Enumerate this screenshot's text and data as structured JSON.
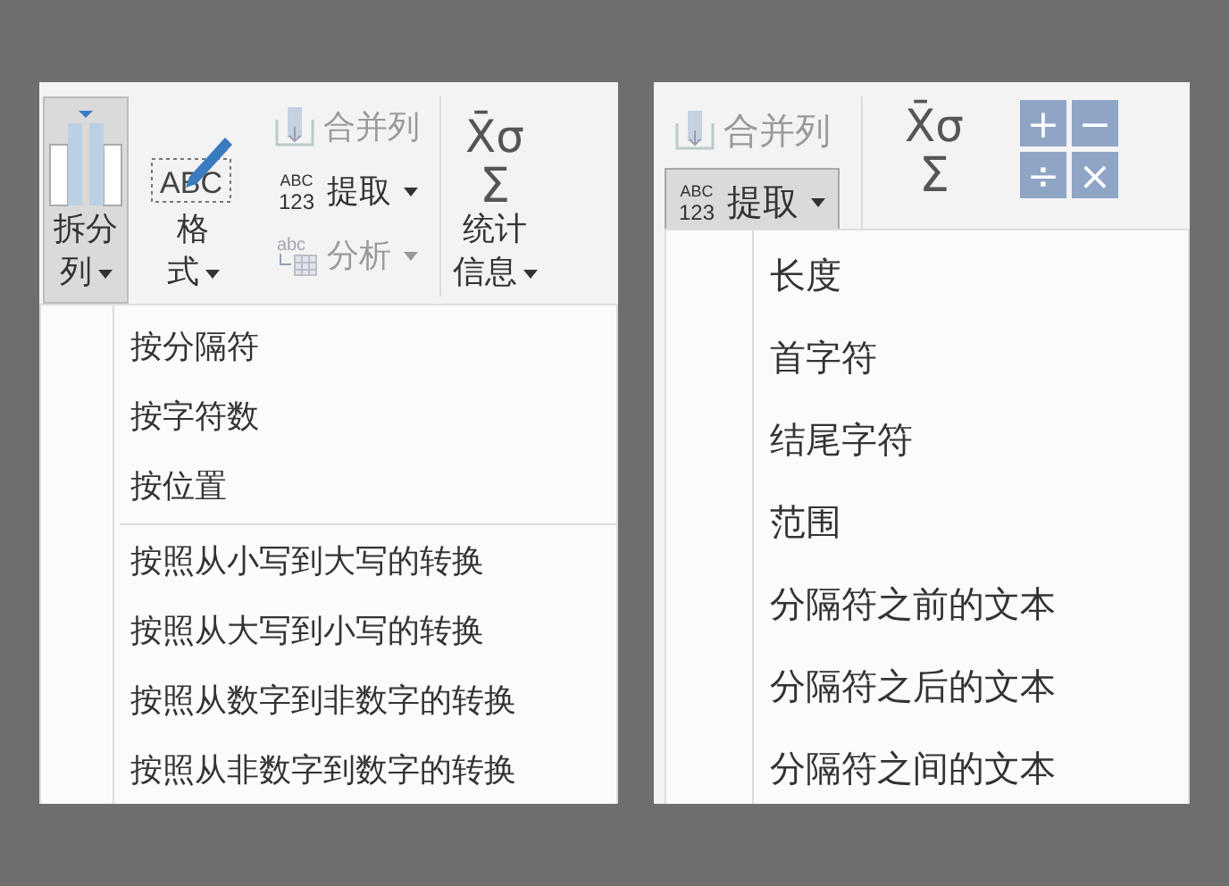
{
  "left_panel": {
    "ribbon": [
      {
        "kind": "split",
        "lines": [
          "拆分",
          "列"
        ],
        "dropdown": true,
        "selected": true
      },
      {
        "kind": "format",
        "icon_text": "ABC",
        "lines": [
          "格",
          "式"
        ],
        "dropdown": true,
        "selected": false
      },
      {
        "kind": "stack",
        "items": [
          {
            "kind": "merge",
            "label": "合并列",
            "dropdown": false,
            "disabled": true,
            "selected": false
          },
          {
            "kind": "extract",
            "icon_text": [
              "ABC",
              "123"
            ],
            "label": "提取",
            "dropdown": true,
            "disabled": false,
            "selected": false
          },
          {
            "kind": "parse",
            "icon_text": "abc",
            "label": "分析",
            "dropdown": true,
            "disabled": true,
            "selected": false
          }
        ]
      },
      {
        "kind": "statistics",
        "icon_text": [
          "X̄σ",
          "Σ"
        ],
        "lines": [
          "统计",
          "信息"
        ],
        "dropdown": true,
        "selected": false
      }
    ],
    "menu": {
      "groups": [
        [
          "按分隔符",
          "按字符数",
          "按位置"
        ],
        [
          "按照从小写到大写的转换",
          "按照从大写到小写的转换",
          "按照从数字到非数字的转换",
          "按照从非数字到数字的转换"
        ]
      ]
    }
  },
  "right_panel": {
    "ribbon": [
      {
        "kind": "stack",
        "items": [
          {
            "kind": "merge",
            "label": "合并列",
            "dropdown": false,
            "disabled": true,
            "selected": false
          },
          {
            "kind": "extract",
            "icon_text": [
              "ABC",
              "123"
            ],
            "label": "提取",
            "dropdown": true,
            "disabled": false,
            "selected": true
          }
        ]
      },
      {
        "kind": "statistics",
        "icon_text": [
          "X̄σ",
          "Σ"
        ]
      },
      {
        "kind": "standard",
        "icon_text": [
          "+",
          "−",
          "÷",
          "×"
        ]
      }
    ],
    "menu": {
      "groups": [
        [
          "长度",
          "首字符",
          "结尾字符",
          "范围",
          "分隔符之前的文本",
          "分隔符之后的文本",
          "分隔符之间的文本"
        ]
      ]
    }
  }
}
